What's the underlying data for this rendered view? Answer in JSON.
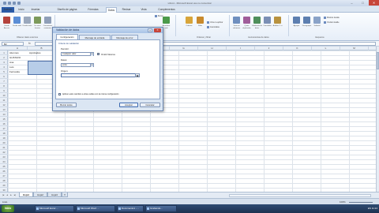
{
  "window": {
    "title": "Libro1 - Microsoft Excel uso no comercial",
    "minimize": "–",
    "maximize": "□",
    "close": "✕"
  },
  "ribbon_tabs": [
    "Archivo",
    "Inicio",
    "Insertar",
    "Diseño de página",
    "Fórmulas",
    "Datos",
    "Revisar",
    "Vista",
    "Complementos"
  ],
  "ribbon": {
    "buttons": [
      "Desde Access",
      "Desde web",
      "Desde texto",
      "De otras fuentes",
      "Conexiones existentes",
      "Actualizar todo",
      "Ordenar",
      "Filtro",
      "Texto en columnas",
      "Quitar duplicados",
      "Validación de datos",
      "Consolidar",
      "Análisis Y si",
      "Agrupar",
      "Desagrupar",
      "Subtotal"
    ],
    "small_items": [
      "Borrar",
      "Volver a aplicar",
      "Avanzadas",
      "Mostrar detalle",
      "Ocultar detalle"
    ],
    "groups": [
      "Obtener datos externos",
      "Conexiones",
      "Ordenar y filtrar",
      "Herramientas de datos",
      "Esquema"
    ]
  },
  "formula_bar": {
    "name_box": "B2",
    "fx": "fx",
    "value": ""
  },
  "grid": {
    "columns": [
      "A",
      "B",
      "C",
      "D",
      "E",
      "F",
      "G",
      "H",
      "I",
      "J",
      "K",
      "L",
      "M"
    ],
    "rows": [
      "1",
      "2",
      "3",
      "4",
      "5",
      "6",
      "7",
      "8",
      "9",
      "10",
      "11",
      "12",
      "13",
      "14",
      "15",
      "16",
      "17",
      "18",
      "19",
      "20",
      "21",
      "22",
      "23",
      "24",
      "25",
      "26",
      "27",
      "28",
      "29",
      "30"
    ],
    "cells": [
      {
        "row": 0,
        "col": 0,
        "text": "Alumnos"
      },
      {
        "row": 0,
        "col": 1,
        "text": "Aprobados"
      },
      {
        "row": 1,
        "col": 0,
        "text": "GUSTAVO"
      },
      {
        "row": 2,
        "col": 0,
        "text": "Ana"
      },
      {
        "row": 3,
        "col": 0,
        "text": "Luis"
      },
      {
        "row": 4,
        "col": 0,
        "text": "Fernanda"
      }
    ]
  },
  "dialog": {
    "title": "Validación de datos",
    "help": "?",
    "close": "✕",
    "tabs": [
      "Configuración",
      "Mensaje de entrada",
      "Mensaje de error"
    ],
    "criteria_label": "Criterio de validación",
    "allow_label": "Permitir:",
    "allow_value": "Cualquier valor",
    "ignore_blank": "Omitir blancos",
    "data_label": "Datos:",
    "data_value": "entre",
    "source_label": "Origen:",
    "apply_all": "Aplicar estos cambios a otras celdas con la misma configuración",
    "clear_all": "Borrar todos",
    "ok": "Aceptar",
    "cancel": "Cancelar"
  },
  "sheets": [
    "Hoja1",
    "Hoja2",
    "Hoja3"
  ],
  "status": {
    "text": "Listo",
    "zoom": "100%"
  },
  "taskbar": {
    "start": "Inicio",
    "items": [
      "Microsoft Excel ...",
      "Microsoft Word ...",
      "Documento1 - ...",
      "Grabando..."
    ],
    "clock": "ES 11:24"
  },
  "colors": {
    "accent": "#2a5ba8",
    "selection": "#b7cde8",
    "taskbar": "#1d3150"
  }
}
